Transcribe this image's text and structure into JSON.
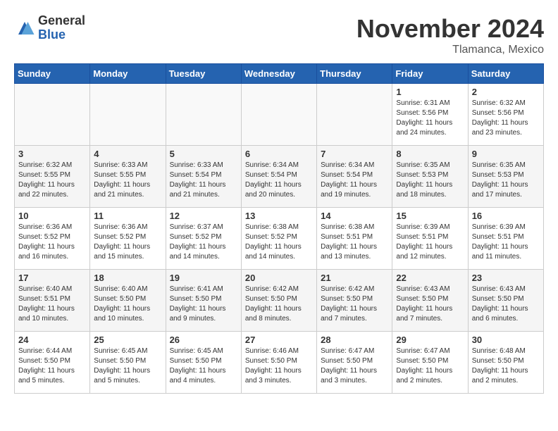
{
  "logo": {
    "general": "General",
    "blue": "Blue"
  },
  "title": "November 2024",
  "location": "Tlamanca, Mexico",
  "weekdays": [
    "Sunday",
    "Monday",
    "Tuesday",
    "Wednesday",
    "Thursday",
    "Friday",
    "Saturday"
  ],
  "weeks": [
    [
      {
        "day": "",
        "info": ""
      },
      {
        "day": "",
        "info": ""
      },
      {
        "day": "",
        "info": ""
      },
      {
        "day": "",
        "info": ""
      },
      {
        "day": "",
        "info": ""
      },
      {
        "day": "1",
        "info": "Sunrise: 6:31 AM\nSunset: 5:56 PM\nDaylight: 11 hours\nand 24 minutes."
      },
      {
        "day": "2",
        "info": "Sunrise: 6:32 AM\nSunset: 5:56 PM\nDaylight: 11 hours\nand 23 minutes."
      }
    ],
    [
      {
        "day": "3",
        "info": "Sunrise: 6:32 AM\nSunset: 5:55 PM\nDaylight: 11 hours\nand 22 minutes."
      },
      {
        "day": "4",
        "info": "Sunrise: 6:33 AM\nSunset: 5:55 PM\nDaylight: 11 hours\nand 21 minutes."
      },
      {
        "day": "5",
        "info": "Sunrise: 6:33 AM\nSunset: 5:54 PM\nDaylight: 11 hours\nand 21 minutes."
      },
      {
        "day": "6",
        "info": "Sunrise: 6:34 AM\nSunset: 5:54 PM\nDaylight: 11 hours\nand 20 minutes."
      },
      {
        "day": "7",
        "info": "Sunrise: 6:34 AM\nSunset: 5:54 PM\nDaylight: 11 hours\nand 19 minutes."
      },
      {
        "day": "8",
        "info": "Sunrise: 6:35 AM\nSunset: 5:53 PM\nDaylight: 11 hours\nand 18 minutes."
      },
      {
        "day": "9",
        "info": "Sunrise: 6:35 AM\nSunset: 5:53 PM\nDaylight: 11 hours\nand 17 minutes."
      }
    ],
    [
      {
        "day": "10",
        "info": "Sunrise: 6:36 AM\nSunset: 5:52 PM\nDaylight: 11 hours\nand 16 minutes."
      },
      {
        "day": "11",
        "info": "Sunrise: 6:36 AM\nSunset: 5:52 PM\nDaylight: 11 hours\nand 15 minutes."
      },
      {
        "day": "12",
        "info": "Sunrise: 6:37 AM\nSunset: 5:52 PM\nDaylight: 11 hours\nand 14 minutes."
      },
      {
        "day": "13",
        "info": "Sunrise: 6:38 AM\nSunset: 5:52 PM\nDaylight: 11 hours\nand 14 minutes."
      },
      {
        "day": "14",
        "info": "Sunrise: 6:38 AM\nSunset: 5:51 PM\nDaylight: 11 hours\nand 13 minutes."
      },
      {
        "day": "15",
        "info": "Sunrise: 6:39 AM\nSunset: 5:51 PM\nDaylight: 11 hours\nand 12 minutes."
      },
      {
        "day": "16",
        "info": "Sunrise: 6:39 AM\nSunset: 5:51 PM\nDaylight: 11 hours\nand 11 minutes."
      }
    ],
    [
      {
        "day": "17",
        "info": "Sunrise: 6:40 AM\nSunset: 5:51 PM\nDaylight: 11 hours\nand 10 minutes."
      },
      {
        "day": "18",
        "info": "Sunrise: 6:40 AM\nSunset: 5:50 PM\nDaylight: 11 hours\nand 10 minutes."
      },
      {
        "day": "19",
        "info": "Sunrise: 6:41 AM\nSunset: 5:50 PM\nDaylight: 11 hours\nand 9 minutes."
      },
      {
        "day": "20",
        "info": "Sunrise: 6:42 AM\nSunset: 5:50 PM\nDaylight: 11 hours\nand 8 minutes."
      },
      {
        "day": "21",
        "info": "Sunrise: 6:42 AM\nSunset: 5:50 PM\nDaylight: 11 hours\nand 7 minutes."
      },
      {
        "day": "22",
        "info": "Sunrise: 6:43 AM\nSunset: 5:50 PM\nDaylight: 11 hours\nand 7 minutes."
      },
      {
        "day": "23",
        "info": "Sunrise: 6:43 AM\nSunset: 5:50 PM\nDaylight: 11 hours\nand 6 minutes."
      }
    ],
    [
      {
        "day": "24",
        "info": "Sunrise: 6:44 AM\nSunset: 5:50 PM\nDaylight: 11 hours\nand 5 minutes."
      },
      {
        "day": "25",
        "info": "Sunrise: 6:45 AM\nSunset: 5:50 PM\nDaylight: 11 hours\nand 5 minutes."
      },
      {
        "day": "26",
        "info": "Sunrise: 6:45 AM\nSunset: 5:50 PM\nDaylight: 11 hours\nand 4 minutes."
      },
      {
        "day": "27",
        "info": "Sunrise: 6:46 AM\nSunset: 5:50 PM\nDaylight: 11 hours\nand 3 minutes."
      },
      {
        "day": "28",
        "info": "Sunrise: 6:47 AM\nSunset: 5:50 PM\nDaylight: 11 hours\nand 3 minutes."
      },
      {
        "day": "29",
        "info": "Sunrise: 6:47 AM\nSunset: 5:50 PM\nDaylight: 11 hours\nand 2 minutes."
      },
      {
        "day": "30",
        "info": "Sunrise: 6:48 AM\nSunset: 5:50 PM\nDaylight: 11 hours\nand 2 minutes."
      }
    ]
  ]
}
